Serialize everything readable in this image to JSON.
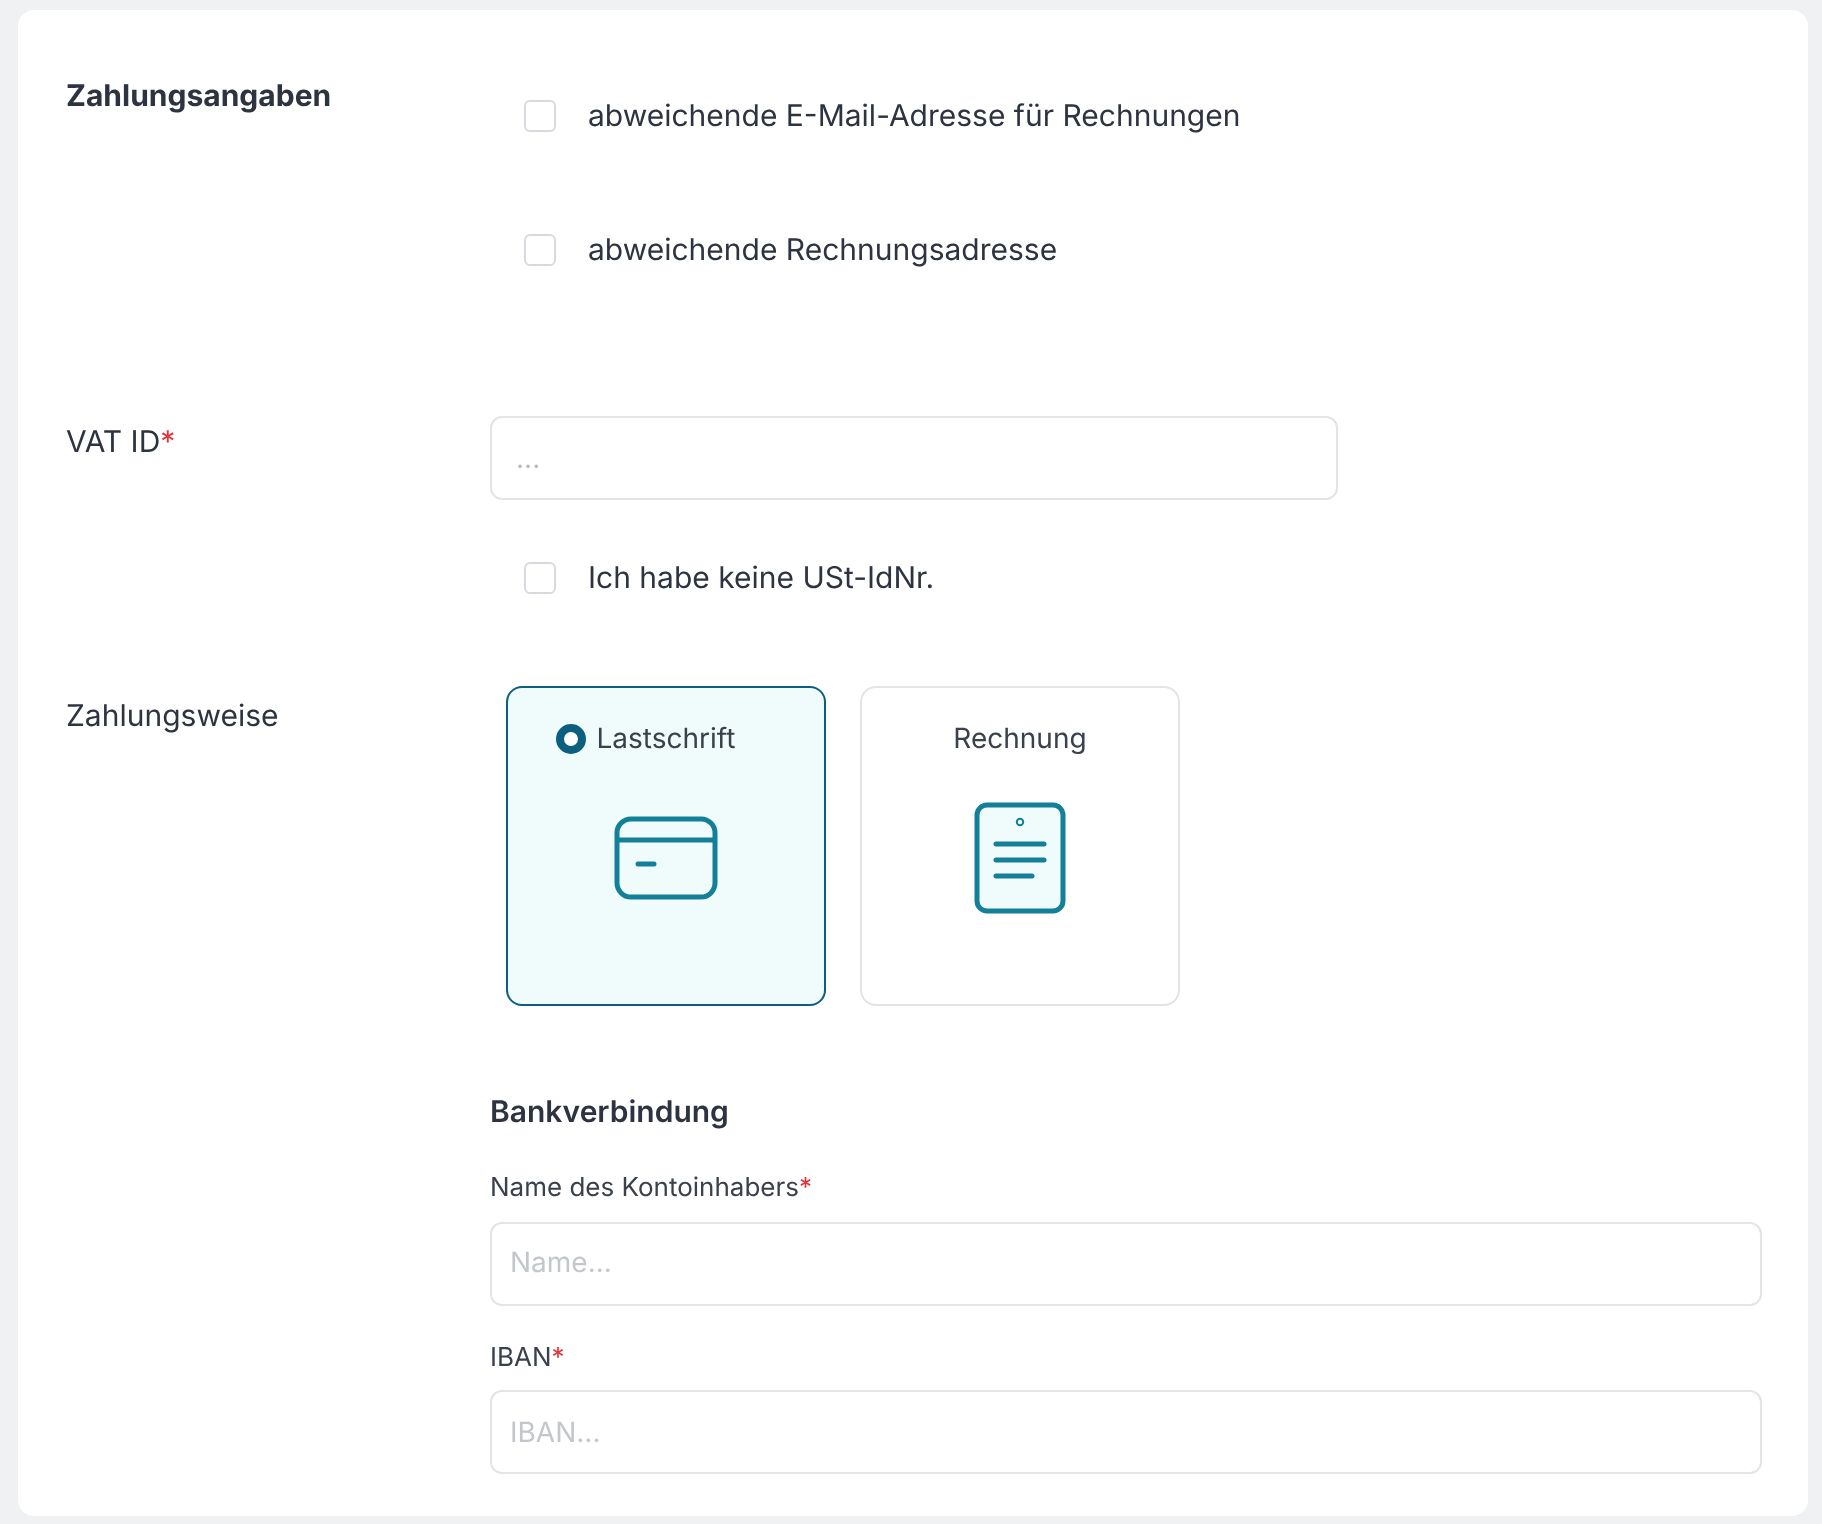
{
  "section_title": "Zahlungsangaben",
  "options": [
    {
      "label": "abweichende E-Mail-Adresse für Rechnungen",
      "checked": false
    },
    {
      "label": "abweichende Rechnungsadresse",
      "checked": false
    }
  ],
  "vat": {
    "label": "VAT ID",
    "required_mark": "*",
    "placeholder": "...",
    "no_vat": {
      "label": "Ich habe keine USt-IdNr.",
      "checked": false
    }
  },
  "payment": {
    "label": "Zahlungsweise",
    "methods": [
      {
        "kind": "debit",
        "label": "Lastschrift",
        "selected": true
      },
      {
        "kind": "invoice",
        "label": "Rechnung",
        "selected": false
      }
    ]
  },
  "bank": {
    "title": "Bankverbindung",
    "fields": [
      {
        "label": "Name des Kontoinhabers",
        "required_mark": "*",
        "placeholder": "Name..."
      },
      {
        "label": "IBAN",
        "required_mark": "*",
        "placeholder": "IBAN..."
      }
    ]
  }
}
